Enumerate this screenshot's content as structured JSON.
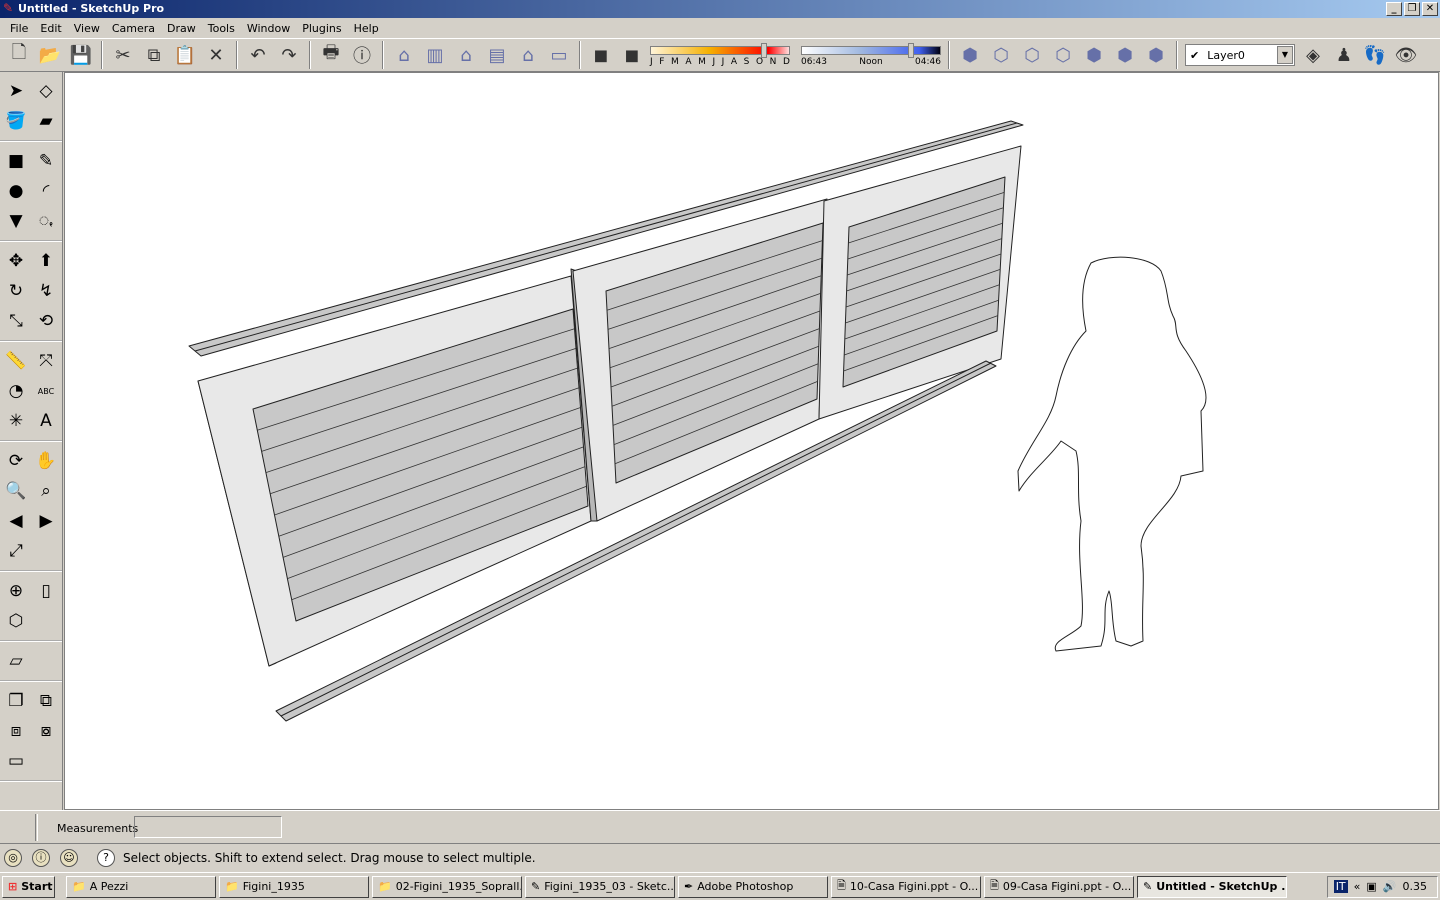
{
  "window": {
    "title": "Untitled - SketchUp Pro",
    "min": "_",
    "max": "❐",
    "close": "✕"
  },
  "menu": [
    "File",
    "Edit",
    "View",
    "Camera",
    "Draw",
    "Tools",
    "Window",
    "Plugins",
    "Help"
  ],
  "toolbar": {
    "icons1": [
      "new-icon",
      "open-icon",
      "save-icon"
    ],
    "icons2": [
      "cut-icon",
      "copy-icon",
      "paste-icon",
      "erase-icon"
    ],
    "icons3": [
      "undo-icon",
      "redo-icon"
    ],
    "icons4": [
      "print-icon",
      "model-info-icon"
    ],
    "views": [
      "iso-view-icon",
      "top-view-icon",
      "front-view-icon",
      "right-view-icon",
      "back-view-icon",
      "left-view-icon"
    ],
    "shadow_icons": [
      "shadow-settings-icon",
      "display-shadows-icon"
    ],
    "months": [
      "J",
      "F",
      "M",
      "A",
      "M",
      "J",
      "J",
      "A",
      "S",
      "O",
      "N",
      "D"
    ],
    "month_value": 0.83,
    "time_labels": {
      "start": "06:43",
      "mid": "Noon",
      "end": "04:46"
    },
    "time_value": 0.8,
    "styles": [
      "xray-icon",
      "wireframe-icon",
      "hidden-line-icon",
      "shaded-icon",
      "shaded-textures-icon",
      "monochrome-icon",
      "back-edges-icon"
    ],
    "layer": {
      "checked": "✔",
      "value": "Layer0"
    },
    "icons5": [
      "layer-manager-icon",
      "position-camera-icon",
      "walk-icon",
      "look-around-icon"
    ]
  },
  "left_tools": [
    [
      "select-icon",
      "component-icon"
    ],
    [
      "paint-bucket-icon",
      "eraser-icon"
    ],
    [
      "rectangle-icon",
      "pencil-icon"
    ],
    [
      "circle-icon",
      "arc-icon"
    ],
    [
      "polygon-icon",
      "freehand-icon"
    ],
    [
      "move-icon",
      "push-pull-icon"
    ],
    [
      "rotate-icon",
      "follow-me-icon"
    ],
    [
      "scale-icon",
      "offset-icon"
    ],
    [
      "tape-measure-icon",
      "dimension-icon"
    ],
    [
      "protractor-icon",
      "text-icon"
    ],
    [
      "axes-icon",
      "3d-text-icon"
    ],
    [
      "orbit-icon",
      "pan-icon"
    ],
    [
      "zoom-icon",
      "zoom-window-icon"
    ],
    [
      "previous-view-icon",
      "next-view-icon"
    ],
    [
      "zoom-extents-icon"
    ],
    [
      "section-plane-icon",
      "section-display-icon"
    ],
    [
      "section-cuts-icon"
    ],
    [
      "sandbox-icon"
    ],
    [
      "outer-shell-icon",
      "intersect-icon"
    ],
    [
      "union-icon",
      "subtract-icon"
    ],
    [
      "trim-icon"
    ]
  ],
  "left_glyphs": {
    "select-icon": "➤",
    "component-icon": "◇",
    "paint-bucket-icon": "🪣",
    "eraser-icon": "▰",
    "rectangle-icon": "■",
    "pencil-icon": "✎",
    "circle-icon": "●",
    "arc-icon": "◜",
    "polygon-icon": "▼",
    "freehand-icon": "ꩻ",
    "move-icon": "✥",
    "push-pull-icon": "⬆",
    "rotate-icon": "↻",
    "follow-me-icon": "↯",
    "scale-icon": "⤡",
    "offset-icon": "⟲",
    "tape-measure-icon": "📏",
    "dimension-icon": "⤧",
    "protractor-icon": "◔",
    "text-icon": "ABC",
    "axes-icon": "✳",
    "3d-text-icon": "A",
    "orbit-icon": "⟳",
    "pan-icon": "✋",
    "zoom-icon": "🔍",
    "zoom-window-icon": "⌕",
    "previous-view-icon": "◀",
    "next-view-icon": "▶",
    "zoom-extents-icon": "⤢",
    "section-plane-icon": "⊕",
    "section-display-icon": "▯",
    "section-cuts-icon": "⬡",
    "sandbox-icon": "▱",
    "outer-shell-icon": "❐",
    "intersect-icon": "⧉",
    "union-icon": "⧈",
    "subtract-icon": "⧇",
    "trim-icon": "▭"
  },
  "measurements": {
    "label": "Measurements",
    "value": ""
  },
  "status": {
    "icons": [
      "geo-location-icon",
      "credits-icon",
      "user-icon"
    ],
    "help": "?",
    "message": "Select objects. Shift to extend select. Drag mouse to select multiple."
  },
  "taskbar": {
    "start": "Start",
    "tasks": [
      {
        "label": "A Pezzi",
        "icon": "folder-icon"
      },
      {
        "label": "Figini_1935",
        "icon": "folder-icon"
      },
      {
        "label": "02-Figini_1935_Soprall...",
        "icon": "folder-icon"
      },
      {
        "label": "Figini_1935_03 - Sketc...",
        "icon": "sketchup-icon"
      },
      {
        "label": "Adobe Photoshop",
        "icon": "photoshop-icon"
      },
      {
        "label": "10-Casa Figini.ppt - O...",
        "icon": "powerpoint-icon"
      },
      {
        "label": "09-Casa Figini.ppt - O...",
        "icon": "powerpoint-icon"
      },
      {
        "label": "Untitled - SketchUp ...",
        "icon": "sketchup-icon",
        "active": true
      }
    ],
    "lang": "IT",
    "clock": "0.35"
  }
}
